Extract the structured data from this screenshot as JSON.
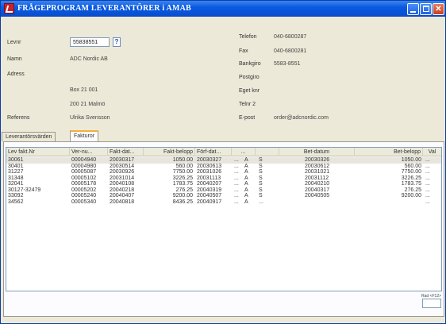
{
  "window": {
    "title": "FRÅGEPROGRAM  LEVERANTÖRER i AMAB",
    "close_glyph": "✕"
  },
  "form": {
    "levnr_label": "Levnr",
    "levnr_value": "55838551",
    "help_label": "?",
    "namn_label": "Namn",
    "namn_value": "ADC Nordic AB",
    "adress_label": "Adress",
    "adress_line1": "Box 21 001",
    "adress_line2": "200 21 Malmö",
    "referens_label": "Referens",
    "referens_value": "Ulrika Svensson",
    "telefon_label": "Telefon",
    "telefon_value": "040-6800287",
    "fax_label": "Fax",
    "fax_value": "040-6800281",
    "bankgiro_label": "Bankgiro",
    "bankgiro_value": "5583-8551",
    "postgiro_label": "Postgiro",
    "eget_knr_label": "Eget knr",
    "telnr2_label": "Telnr 2",
    "epost_label": "E-post",
    "epost_value": "order@adcnordic.com"
  },
  "tabs": [
    "Leverantörsvärden",
    "Fakturor"
  ],
  "grid": {
    "headers": [
      "Lev fakt.Nr",
      "Ver-nu...",
      "Fakt-dat...",
      "Fakt-belopp",
      "Förf-dat...",
      "...",
      "",
      "Bet-datum",
      "Bet-belopp",
      "Val"
    ],
    "rows": [
      [
        "30061",
        "00004940",
        "20030317",
        "1050.00",
        "20030327",
        "...",
        "A",
        "S",
        "20030326",
        "1050.00",
        "..."
      ],
      [
        "30401",
        "00004980",
        "20030514",
        "560.00",
        "20030613",
        "...",
        "A",
        "S",
        "20030612",
        "560.00",
        "..."
      ],
      [
        "31227",
        "00005087",
        "20030926",
        "7750.00",
        "20031026",
        "...",
        "A",
        "S",
        "20031021",
        "7750.00",
        "..."
      ],
      [
        "31348",
        "00005102",
        "20031014",
        "3226.25",
        "20031113",
        "...",
        "A",
        "S",
        "20031112",
        "3226.25",
        "..."
      ],
      [
        "32041",
        "00005178",
        "20040108",
        "1783.75",
        "20040207",
        "...",
        "A",
        "S",
        "20040210",
        "1783.75",
        "..."
      ],
      [
        "30127-32479",
        "00005202",
        "20040218",
        "276.25",
        "20040319",
        "...",
        "A",
        "S",
        "20040317",
        "276.25",
        "..."
      ],
      [
        "33092",
        "00005240",
        "20040407",
        "9200.00",
        "20040507",
        "...",
        "A",
        "S",
        "20040505",
        "9200.00",
        "..."
      ],
      [
        "34562",
        "00005340",
        "20040818",
        "8436.25",
        "20040917",
        "...",
        "A",
        "...",
        "",
        "",
        "..."
      ]
    ]
  },
  "rad_label": "Rad <F12>",
  "colors": {
    "titlebar": "#0a5ae0",
    "window_bg": "#ece9d8",
    "selected_row": "#e8e6dc",
    "close_button": "#c5421e"
  }
}
